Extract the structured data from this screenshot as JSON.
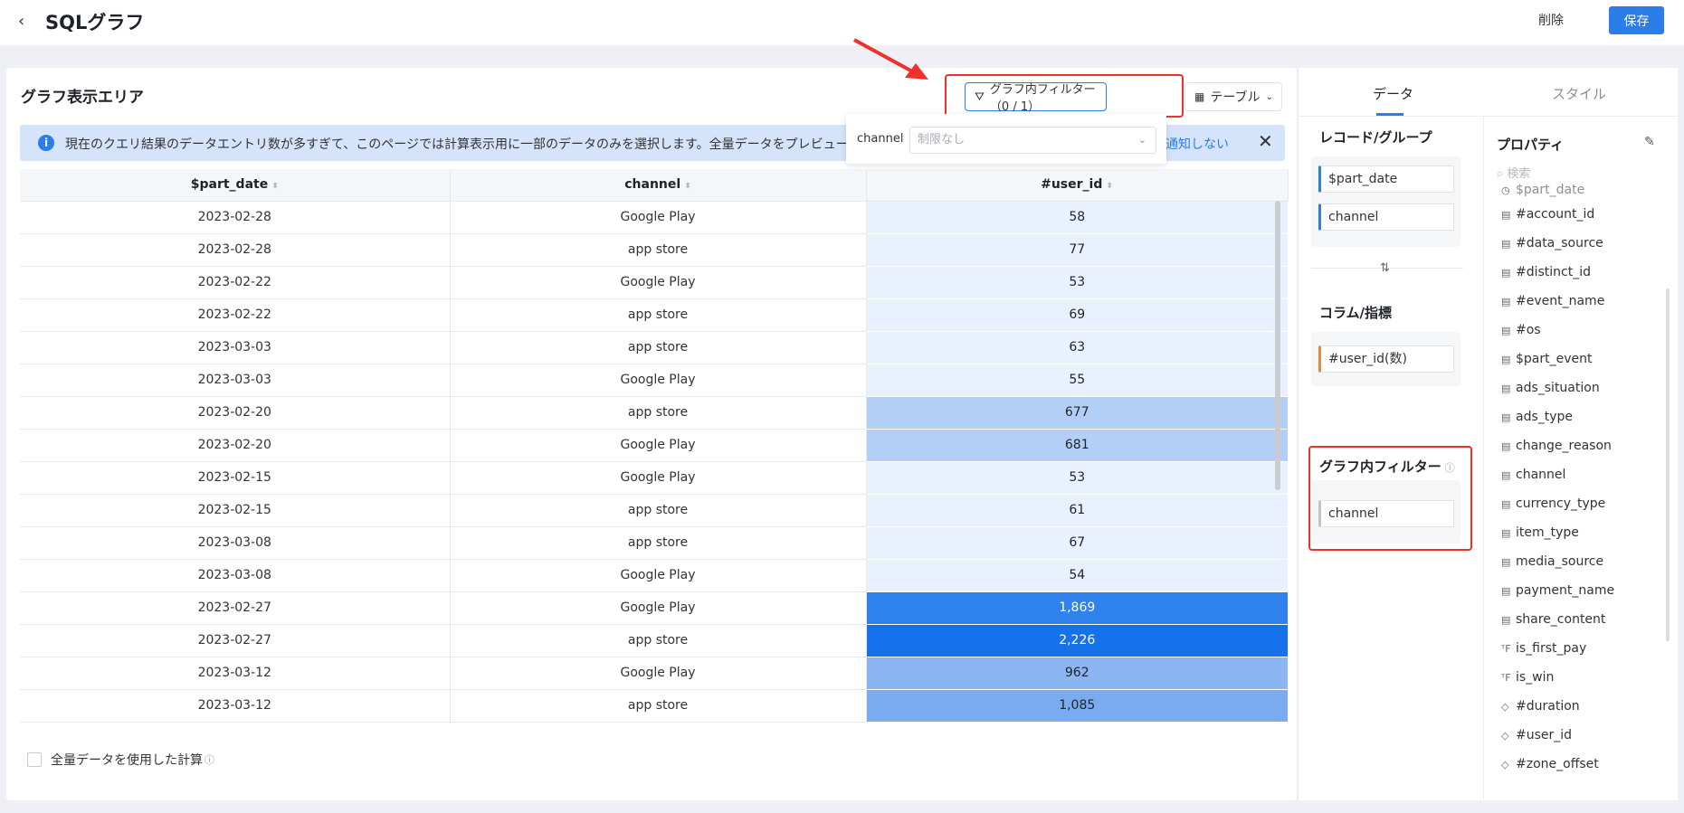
{
  "header": {
    "back_icon": "chevron-left-icon",
    "title": "SQLグラフ",
    "delete_label": "削除",
    "save_label": "保存"
  },
  "main": {
    "area_title": "グラフ表示エリア",
    "filter_button_label": "グラフ内フィルター（0 / 1）",
    "table_button_label": "テーブル",
    "banner": {
      "text": "現在のクエリ結果のデータエントリ数が多すぎて、このページでは計算表示用に一部のデータのみを選択します。全量データをプレビュー",
      "link": "通知しない"
    },
    "popover": {
      "label": "channel",
      "placeholder": "制限なし"
    },
    "table": {
      "headers": [
        "$part_date",
        "channel",
        "#user_id"
      ],
      "rows": [
        {
          "date": "2023-02-28",
          "channel": "Google Play",
          "value": "58",
          "shade": "#e8f1fd",
          "text": "#1f2329"
        },
        {
          "date": "2023-02-28",
          "channel": "app store",
          "value": "77",
          "shade": "#e8f1fd",
          "text": "#1f2329"
        },
        {
          "date": "2023-02-22",
          "channel": "Google Play",
          "value": "53",
          "shade": "#e8f1fd",
          "text": "#1f2329"
        },
        {
          "date": "2023-02-22",
          "channel": "app store",
          "value": "69",
          "shade": "#e8f1fd",
          "text": "#1f2329"
        },
        {
          "date": "2023-03-03",
          "channel": "app store",
          "value": "63",
          "shade": "#e8f1fd",
          "text": "#1f2329"
        },
        {
          "date": "2023-03-03",
          "channel": "Google Play",
          "value": "55",
          "shade": "#e8f1fd",
          "text": "#1f2329"
        },
        {
          "date": "2023-02-20",
          "channel": "app store",
          "value": "677",
          "shade": "#b3cff7",
          "text": "#1f2329"
        },
        {
          "date": "2023-02-20",
          "channel": "Google Play",
          "value": "681",
          "shade": "#b3cff7",
          "text": "#1f2329"
        },
        {
          "date": "2023-02-15",
          "channel": "Google Play",
          "value": "53",
          "shade": "#e8f1fd",
          "text": "#1f2329"
        },
        {
          "date": "2023-02-15",
          "channel": "app store",
          "value": "61",
          "shade": "#e8f1fd",
          "text": "#1f2329"
        },
        {
          "date": "2023-03-08",
          "channel": "app store",
          "value": "67",
          "shade": "#e8f1fd",
          "text": "#1f2329"
        },
        {
          "date": "2023-03-08",
          "channel": "Google Play",
          "value": "54",
          "shade": "#e8f1fd",
          "text": "#1f2329"
        },
        {
          "date": "2023-02-27",
          "channel": "Google Play",
          "value": "1,869",
          "shade": "#2f82ec",
          "text": "#ffffff"
        },
        {
          "date": "2023-02-27",
          "channel": "app store",
          "value": "2,226",
          "shade": "#1672ea",
          "text": "#ffffff"
        },
        {
          "date": "2023-03-12",
          "channel": "Google Play",
          "value": "962",
          "shade": "#8bb6f2",
          "text": "#1f2329"
        },
        {
          "date": "2023-03-12",
          "channel": "app store",
          "value": "1,085",
          "shade": "#7aabf1",
          "text": "#1f2329"
        }
      ]
    },
    "footer_checkbox_label": "全量データを使用した計算"
  },
  "side": {
    "tab_data": "データ",
    "tab_style": "スタイル",
    "group_title": "レコード/グループ",
    "group_chips": [
      "$part_date",
      "channel"
    ],
    "metric_title": "コラム/指標",
    "metric_chip": "#user_id(数)",
    "filter_title": "グラフ内フィルター",
    "filter_chip": "channel",
    "prop_title": "プロパティ",
    "search_placeholder": "検索",
    "properties": [
      {
        "name": "$part_date",
        "glyph": "◷"
      },
      {
        "name": "#account_id",
        "glyph": "▤"
      },
      {
        "name": "#data_source",
        "glyph": "▤"
      },
      {
        "name": "#distinct_id",
        "glyph": "▤"
      },
      {
        "name": "#event_name",
        "glyph": "▤"
      },
      {
        "name": "#os",
        "glyph": "▤"
      },
      {
        "name": "$part_event",
        "glyph": "▤"
      },
      {
        "name": "ads_situation",
        "glyph": "▤"
      },
      {
        "name": "ads_type",
        "glyph": "▤"
      },
      {
        "name": "change_reason",
        "glyph": "▤"
      },
      {
        "name": "channel",
        "glyph": "▤"
      },
      {
        "name": "currency_type",
        "glyph": "▤"
      },
      {
        "name": "item_type",
        "glyph": "▤"
      },
      {
        "name": "media_source",
        "glyph": "▤"
      },
      {
        "name": "payment_name",
        "glyph": "▤"
      },
      {
        "name": "share_content",
        "glyph": "▤"
      },
      {
        "name": "is_first_pay",
        "glyph": "ᵀF"
      },
      {
        "name": "is_win",
        "glyph": "ᵀF"
      },
      {
        "name": "#duration",
        "glyph": "◇"
      },
      {
        "name": "#user_id",
        "glyph": "◇"
      },
      {
        "name": "#zone_offset",
        "glyph": "◇"
      }
    ]
  }
}
